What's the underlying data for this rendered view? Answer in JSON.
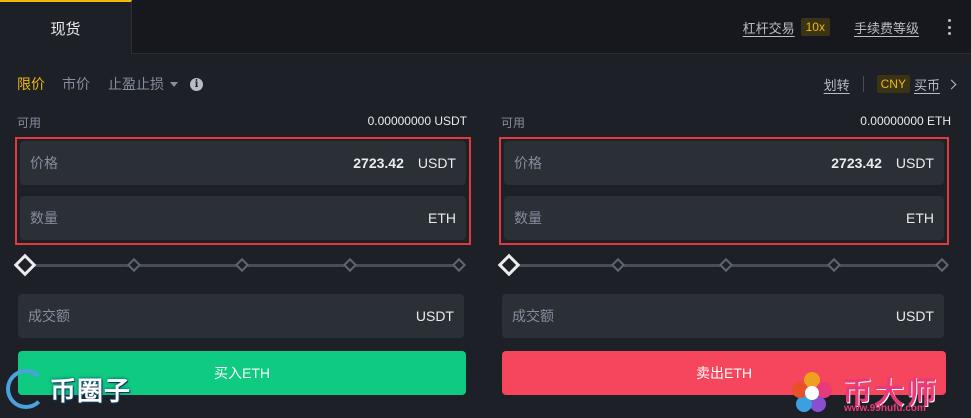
{
  "topbar": {
    "tab_spot": "现货",
    "margin_link": "杠杆交易",
    "margin_badge": "10x",
    "fee_link": "手续费等级"
  },
  "order_types": {
    "limit": "限价",
    "market": "市价",
    "stop": "止盈止损",
    "info_icon_glyph": "i",
    "transfer": "划转",
    "cny_badge": "CNY",
    "buy_coin": "买币"
  },
  "buy": {
    "available_label": "可用",
    "available_value": "0.00000000 USDT",
    "price_label": "价格",
    "price_value": "2723.42",
    "price_unit": "USDT",
    "qty_label": "数量",
    "qty_unit": "ETH",
    "total_label": "成交额",
    "total_unit": "USDT",
    "button_label": "买入ETH",
    "slider_value_percent": 0
  },
  "sell": {
    "available_label": "可用",
    "available_value": "0.00000000 ETH",
    "price_label": "价格",
    "price_value": "2723.42",
    "price_unit": "USDT",
    "qty_label": "数量",
    "qty_unit": "ETH",
    "total_label": "成交额",
    "total_unit": "USDT",
    "button_label": "卖出ETH",
    "slider_value_percent": 0
  },
  "watermarks": {
    "left_text": "币圈子",
    "right_text": "币大师",
    "right_url": "www.99hufu.com"
  },
  "colors": {
    "accent": "#f0b90b",
    "buy": "#0ecb81",
    "sell": "#f6465d",
    "highlight_box": "#e03a3e"
  },
  "icons": [
    "caret-down-icon",
    "info-icon",
    "chevron-right-icon",
    "more-vertical-icon",
    "slider-knob-icon"
  ]
}
